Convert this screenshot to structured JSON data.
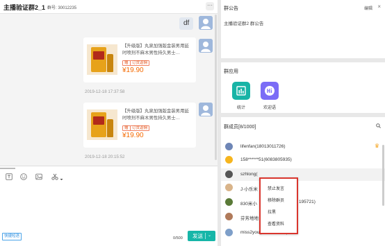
{
  "chat": {
    "title": "主播验证群2_1",
    "group_id": "群号: 30012235",
    "more": "···",
    "messages": [
      {
        "text": "df"
      }
    ],
    "product_cards": [
      {
        "title": "【升级版】丸泉加强版金装男用延时喷剂不麻木男性持久男士…",
        "tags": [
          "赠",
          "订货返佣"
        ],
        "price": "¥19.90",
        "timestamp": "2019-12-18 17:37:58"
      },
      {
        "title": "【升级版】丸泉加强版金装男用延时喷剂不麻木男性持久男士…",
        "tags": [
          "赠",
          "订货返佣"
        ],
        "price": "¥19.90",
        "timestamp": "2019-12-18 20:15:52"
      }
    ],
    "toolbar_icons": [
      "text-icon",
      "emoji-icon",
      "image-icon",
      "scissors-icon"
    ],
    "input_value": "",
    "shortcut_label": "快捷短语",
    "char_count": "0/500",
    "send_label": "发送",
    "send_caret": "⌄"
  },
  "notice": {
    "title": "群公告",
    "edit_label": "编辑",
    "close": "×",
    "content": "主播验证群2 群公告"
  },
  "apps": {
    "title": "群应用",
    "items": [
      {
        "label": "统计",
        "icon": "stats-icon",
        "color": "#18b4a6"
      },
      {
        "label": "欢迎语",
        "icon": "hi-icon",
        "color": "#7b6cf6"
      }
    ]
  },
  "members": {
    "title": "群成员[8/1000]",
    "items": [
      {
        "name": "lifenfan(18013011726)",
        "avatar_color": "#6e86b6",
        "owner": true
      },
      {
        "name": "158******51(6083805935)",
        "avatar_color": "#f6b51e",
        "owner": false
      },
      {
        "name": "szhlong(",
        "avatar_color": "#555555",
        "owner": false
      },
      {
        "name": "J·小乐米",
        "avatar_color": "#d9b48a",
        "owner": false
      },
      {
        "name": "830米小",
        "avatar_color": "#5a7a38",
        "owner": false
      },
      {
        "name": "芬芳地地",
        "avatar_color": "#b07a5a",
        "owner": false
      },
      {
        "name": "miss2you(7046241608)",
        "avatar_color": "#7e9fc9",
        "owner": false
      }
    ],
    "overflow_fragments": [
      "195721)"
    ],
    "crown": "♛"
  },
  "context_menu": {
    "items": [
      "禁止发言",
      "移除群员",
      "拉黑",
      "查看资料"
    ]
  }
}
